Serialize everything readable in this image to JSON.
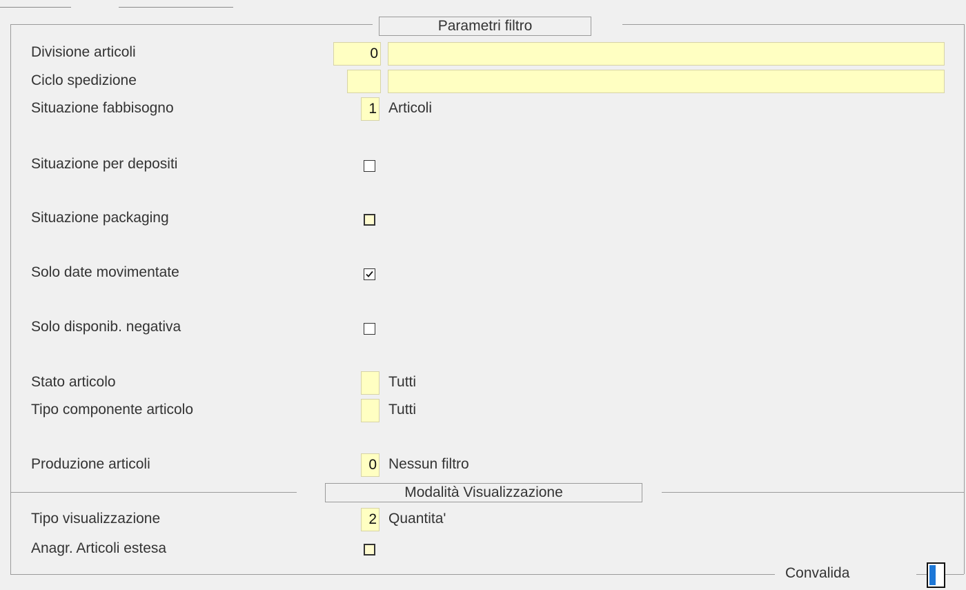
{
  "filtro": {
    "title": "Parametri filtro",
    "divisione": {
      "label": "Divisione articoli",
      "code": "0",
      "desc": ""
    },
    "ciclo": {
      "label": "Ciclo spedizione",
      "code": "",
      "desc": ""
    },
    "fabbisogno": {
      "label": "Situazione fabbisogno",
      "code": "1",
      "desc": "Articoli"
    },
    "depositi": {
      "label": "Situazione per depositi",
      "checked": false
    },
    "packaging": {
      "label": "Situazione packaging",
      "checked": false
    },
    "date_mov": {
      "label": "Solo date movimentate",
      "checked": true
    },
    "disp_neg": {
      "label": "Solo disponib. negativa",
      "checked": false
    },
    "stato": {
      "label": "Stato articolo",
      "code": "",
      "desc": "Tutti"
    },
    "tipo_comp": {
      "label": "Tipo componente articolo",
      "code": "",
      "desc": "Tutti"
    },
    "produzione": {
      "label": "Produzione articoli",
      "code": "0",
      "desc": "Nessun filtro"
    }
  },
  "visualizzazione": {
    "title": "Modalità Visualizzazione",
    "tipo": {
      "label": "Tipo visualizzazione",
      "code": "2",
      "desc": "Quantita'"
    },
    "anagr": {
      "label": "Anagr. Articoli estesa",
      "checked": false
    }
  },
  "footer": {
    "convalida_label": "Convalida"
  },
  "colors": {
    "field_bg": "#ffffc2",
    "accent": "#1e78d7",
    "background": "#f0f0f0"
  }
}
